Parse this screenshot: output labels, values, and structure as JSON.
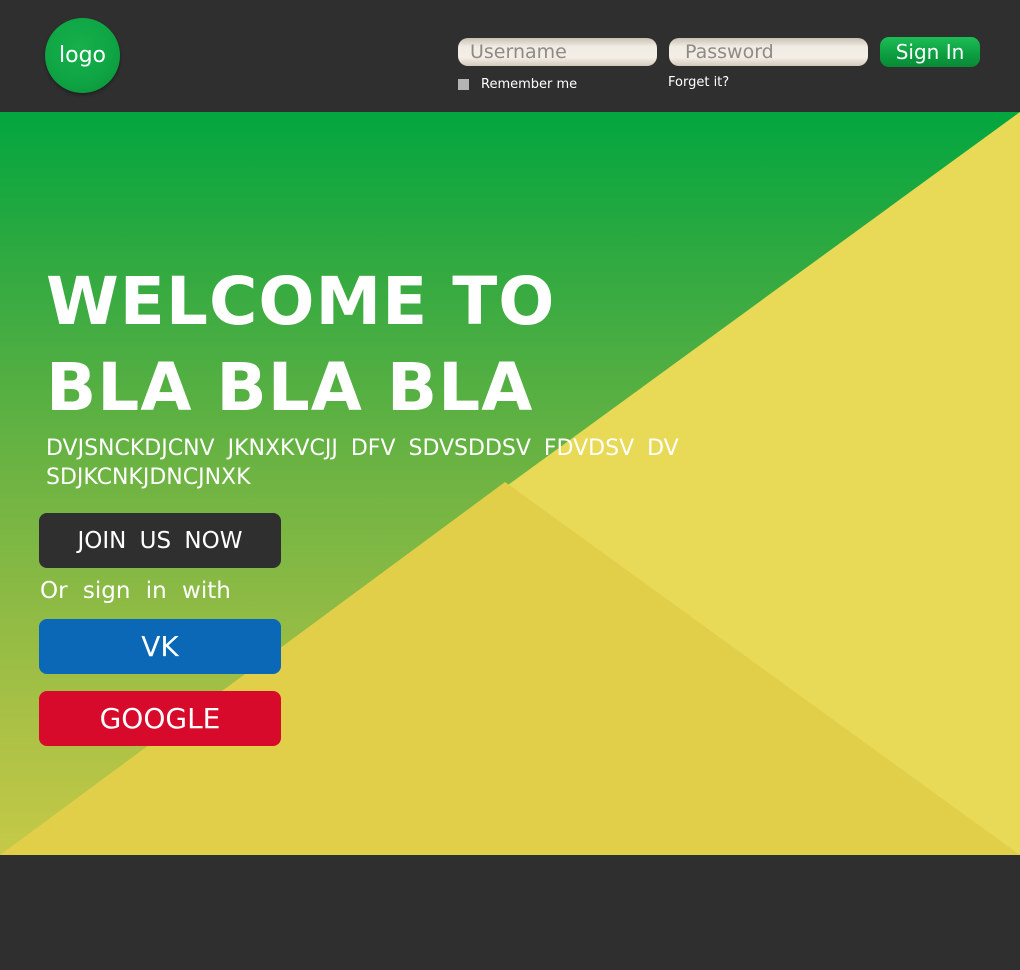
{
  "header": {
    "logo_text": "logo",
    "username_placeholder": "Username",
    "password_placeholder": "Password",
    "signin_label": "Sign In",
    "remember_label": "Remember me",
    "forget_label": "Forget it?"
  },
  "hero": {
    "title_line1": "WELCOME TO",
    "title_line2": "BLA BLA BLA",
    "subtitle": "DVJSNCKDJCNV JKNXKVCJJ DFV SDVSDDSV FDVDSV DV SDJKCNKJDNCJNXK",
    "join_label": "JOIN US NOW",
    "or_text": "Or sign in with",
    "vk_label": "VK",
    "google_label": "GOOGLE"
  },
  "colors": {
    "dark": "#2f2f2f",
    "green": "#03a63f",
    "yellow": "#e8d955",
    "vk_blue": "#0a68b6",
    "google_red": "#d80a2b"
  }
}
